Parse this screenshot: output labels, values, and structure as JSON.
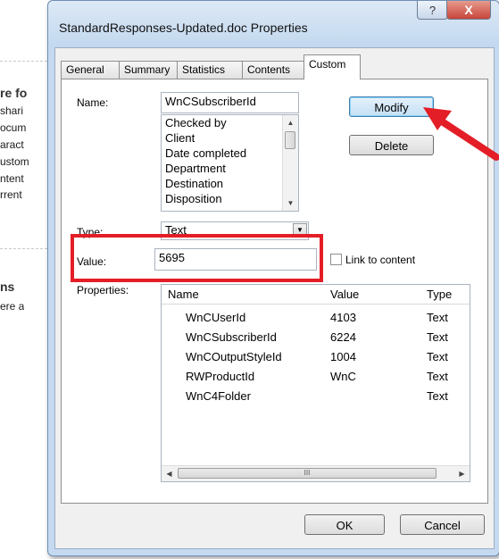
{
  "background": {
    "fragments": [
      "re fo",
      "shari",
      "ocum",
      "aract",
      "ustom",
      "ntent",
      "rrent",
      "ns",
      "ere a"
    ]
  },
  "window": {
    "title": "StandardResponses-Updated.doc Properties",
    "help_label": "?",
    "close_label": "X"
  },
  "tabs": [
    {
      "label": "General"
    },
    {
      "label": "Summary"
    },
    {
      "label": "Statistics"
    },
    {
      "label": "Contents"
    },
    {
      "label": "Custom"
    }
  ],
  "custom": {
    "name_label": "Name:",
    "name_value": "WnCSubscriberId",
    "name_options": [
      "Checked by",
      "Client",
      "Date completed",
      "Department",
      "Destination",
      "Disposition"
    ],
    "type_label": "Type:",
    "type_value": "Text",
    "value_label": "Value:",
    "value_value": "5695",
    "link_label": "Link to content",
    "properties_label": "Properties:",
    "modify_label": "Modify",
    "delete_label": "Delete"
  },
  "properties_table": {
    "columns": [
      "Name",
      "Value",
      "Type"
    ],
    "rows": [
      {
        "name": "WnCUserId",
        "value": "4103",
        "type": "Text"
      },
      {
        "name": "WnCSubscriberId",
        "value": "6224",
        "type": "Text"
      },
      {
        "name": "WnCOutputStyleId",
        "value": "1004",
        "type": "Text"
      },
      {
        "name": "RWProductId",
        "value": "WnC",
        "type": "Text"
      },
      {
        "name": "WnC4Folder",
        "value": "",
        "type": "Text"
      }
    ]
  },
  "footer": {
    "ok_label": "OK",
    "cancel_label": "Cancel"
  },
  "colors": {
    "highlight": "#e41e26",
    "window_frame": "#c5daf0"
  }
}
